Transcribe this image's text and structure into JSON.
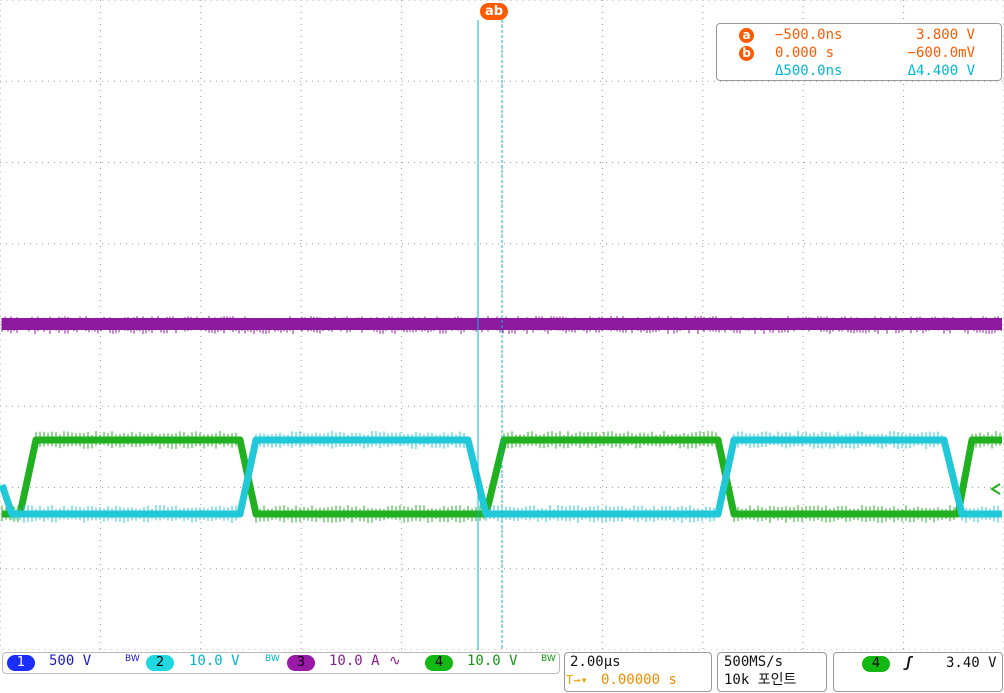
{
  "cursor_marker_label": "ab",
  "cursor_readout": {
    "a": {
      "marker": "a",
      "time": "−500.0ns",
      "value": "3.800 V"
    },
    "b": {
      "marker": "b",
      "time": "0.000 s",
      "value": "−600.0mV"
    },
    "delta": {
      "time": "Δ500.0ns",
      "value": "Δ4.400 V"
    }
  },
  "channels": [
    {
      "number": "1",
      "scale": "500 V",
      "bw": "BW",
      "color": "#1530ff",
      "text_color": "#1a1acc"
    },
    {
      "number": "2",
      "scale": "10.0 V",
      "bw": "BW",
      "color": "#20d8e0",
      "text_color": "#00b4cc"
    },
    {
      "number": "3",
      "scale": "10.0 A",
      "coupling": "∿",
      "color": "#9a1aa8",
      "text_color": "#8a1a96"
    },
    {
      "number": "4",
      "scale": "10.0 V",
      "bw": "BW",
      "color": "#14b814",
      "text_color": "#119911"
    }
  ],
  "horizontal": {
    "scale": "2.00µs",
    "position_icon": "T→▾",
    "position": "0.00000 s"
  },
  "acquisition": {
    "sample_rate": "500MS/s",
    "record_length": "10k 포인트"
  },
  "trigger": {
    "source": "4",
    "slope_icon": "rising-edge-icon",
    "slope_glyph": "ʃ",
    "level": "3.40 V"
  },
  "colors": {
    "ch2": "#20c8d8",
    "ch3": "#8c1a9c",
    "ch4": "#20b020",
    "cursor": "#00b8d8",
    "accent": "#ff5a00"
  }
}
